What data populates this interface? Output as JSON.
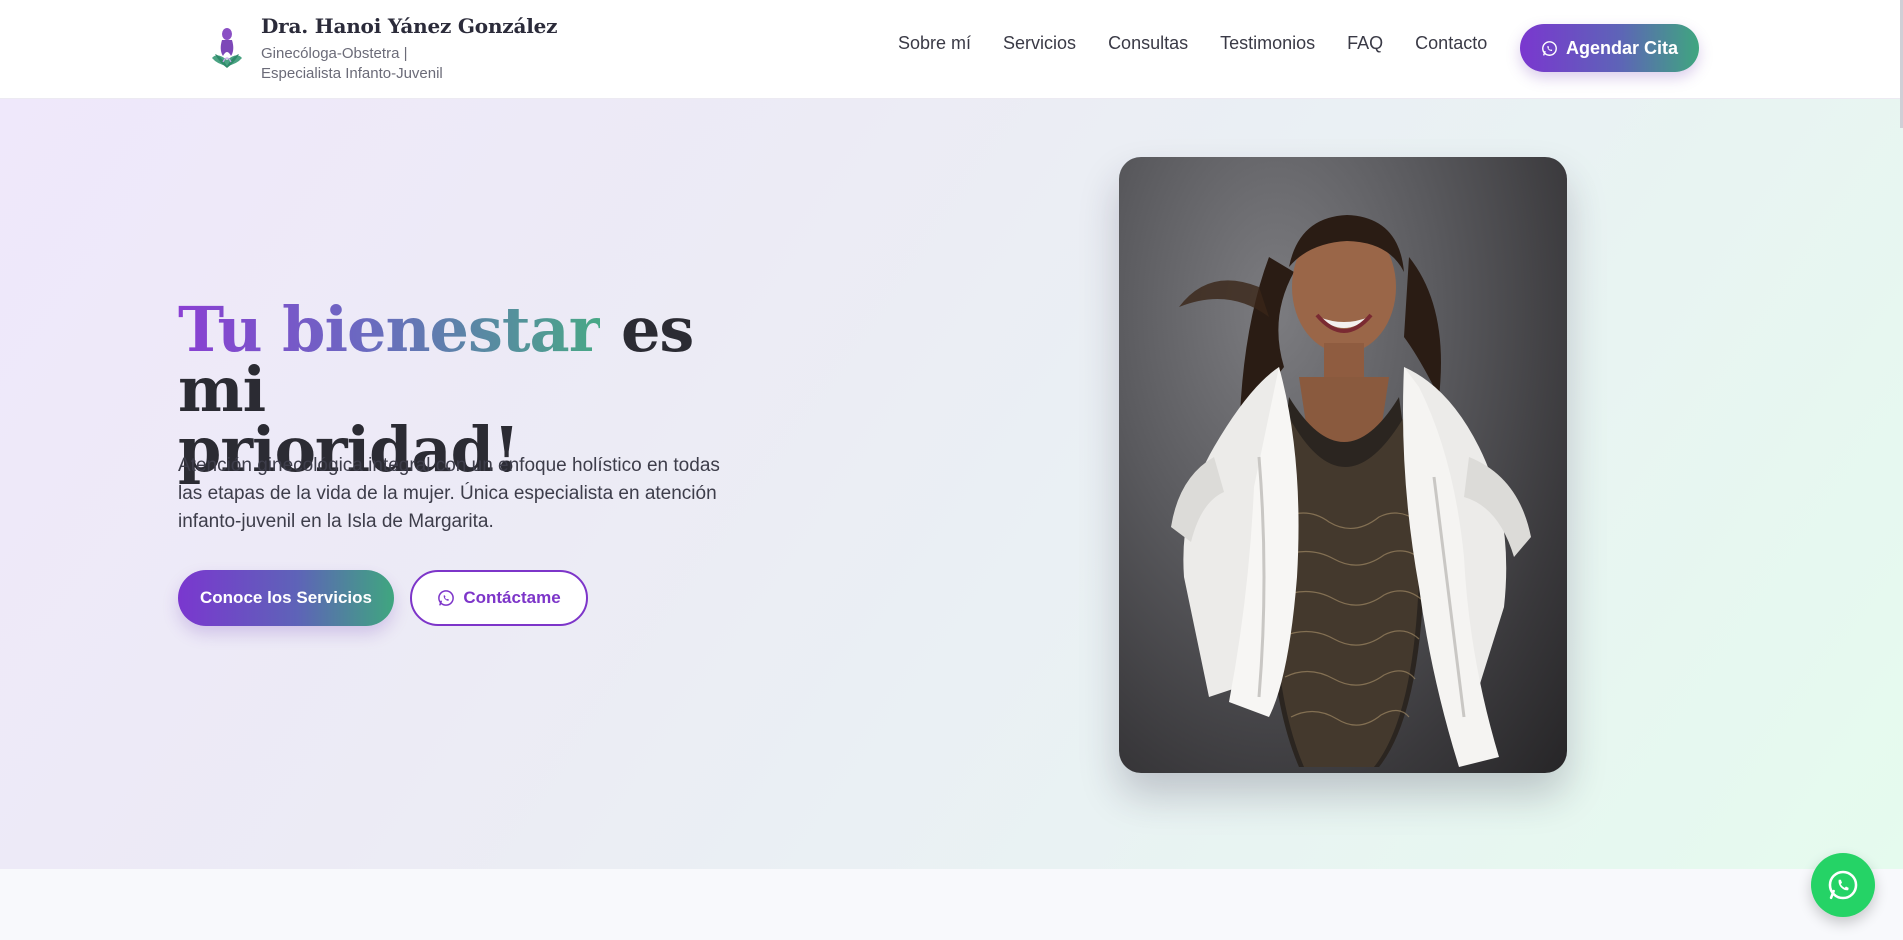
{
  "header": {
    "brand_name": "Dra. Hanoi Yánez González",
    "brand_sub_line1": "Ginecóloga-Obstetra |",
    "brand_sub_line2": "Especialista Infanto-Juvenil",
    "logo_icon": "lotus-woman-logo",
    "nav": [
      {
        "label": "Sobre mí"
      },
      {
        "label": "Servicios"
      },
      {
        "label": "Consultas"
      },
      {
        "label": "Testimonios"
      },
      {
        "label": "FAQ"
      },
      {
        "label": "Contacto"
      }
    ],
    "cta_label": "Agendar Cita",
    "cta_icon": "whatsapp-icon"
  },
  "hero": {
    "title_highlight": "Tu bienestar",
    "title_rest_line1": " es mi",
    "title_line2": "prioridad!",
    "description": "Atención ginecológica integral con un enfoque holístico en todas las etapas de la vida de la mujer. Única especialista en atención infanto-juvenil en la Isla de Margarita.",
    "primary_button": "Conoce los Servicios",
    "secondary_button": "Contáctame",
    "secondary_icon": "whatsapp-icon",
    "photo_subject": "doctor-portrait"
  },
  "floating_button_icon": "whatsapp-icon",
  "colors": {
    "primary": "#7a37cf",
    "accent_green": "#3fa67f",
    "whatsapp": "#25d366",
    "text_dark": "#2b2b33"
  }
}
